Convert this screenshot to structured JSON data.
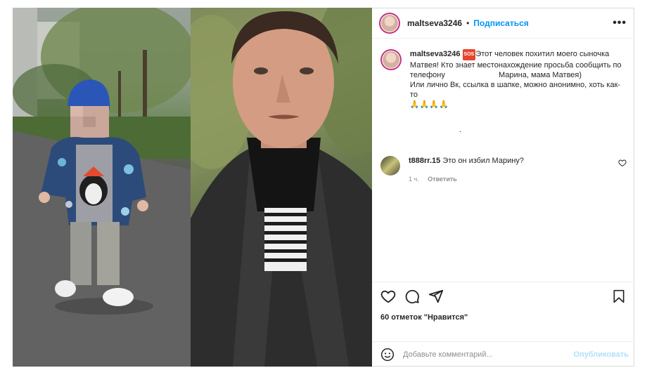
{
  "post": {
    "author": "maltseva3246",
    "follow_label": "Подписаться",
    "separator": "•",
    "more_label": "•••",
    "caption": {
      "username": "maltseva3246",
      "badge": "SOS",
      "line1": "Этот человек похитил моего сыночка Матвея! Кто знает местонахождение просьба сообщить по телефону",
      "line2": "Марина, мама Матвея)",
      "line3": "Или лично Вк, ссылка в шапке, можно анонимно, хоть как-то",
      "emoji": "🙏🙏🙏🙏",
      "trailing": "."
    },
    "comment": {
      "username": "t888rr.15",
      "text": "Это он избил Марину?",
      "time": "1 ч.",
      "reply_label": "Ответить"
    },
    "likes": "60 отметок \"Нравится\"",
    "add_comment": {
      "placeholder": "Добавьте комментарий...",
      "publish_label": "Опубликовать"
    }
  },
  "colors": {
    "accent": "#0095f6",
    "publish_disabled": "#b2dffc",
    "border": "#dbdbdb",
    "muted": "#8e8e8e"
  },
  "icons": [
    "heart-icon",
    "comment-icon",
    "share-icon",
    "bookmark-icon",
    "emoji-icon",
    "more-icon",
    "small-heart-icon"
  ]
}
